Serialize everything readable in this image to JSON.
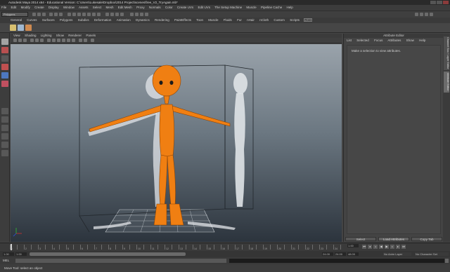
{
  "app": {
    "window_title": "Autodesk Maya 2014 x64 - Educational Version: C:\\Users\\Lukesale\\Dropbox\\2014 Project\\scenes\\free_V2_TryAgain.mb*"
  },
  "menubar": [
    "File",
    "Edit",
    "Modify",
    "Create",
    "Display",
    "Window",
    "Assets",
    "Select",
    "Mesh",
    "Edit Mesh",
    "Proxy",
    "Normals",
    "Color",
    "Create UVs",
    "Edit UVs",
    "The Setup Machine",
    "Muscle",
    "Pipeline Cache",
    "Help"
  ],
  "statusline": {
    "mode": "Polygons"
  },
  "shelf": {
    "tabs": [
      "General",
      "Curves",
      "Surfaces",
      "Polygons",
      "Subdivs",
      "Deformation",
      "Animation",
      "Dynamics",
      "Rendering",
      "PaintEffects",
      "Toon",
      "Muscle",
      "Fluids",
      "Fur",
      "nHair",
      "nCloth",
      "Custom",
      "Scripts",
      "Ross"
    ],
    "active_tab": "Ross"
  },
  "viewport": {
    "menu": [
      "View",
      "Shading",
      "Lighting",
      "Show",
      "Renderer",
      "Panels"
    ],
    "colors": {
      "character": "#f07f12",
      "bg_top": "#9aa3ab",
      "bg_bottom": "#2c343d"
    }
  },
  "attribute_editor": {
    "title": "Attribute Editor",
    "menu": [
      "List",
      "Selected",
      "Focus",
      "Attributes",
      "Show",
      "Help"
    ],
    "message": "Make a selection to view attributes.",
    "buttons": [
      "Select",
      "Load Attributes",
      "Copy Tab"
    ],
    "side_tabs": [
      "Channel Box / Layer Editor",
      "Attribute Editor"
    ]
  },
  "time": {
    "ticks": [
      "1",
      "2",
      "3",
      "4",
      "5",
      "6",
      "7",
      "8",
      "9",
      "10",
      "11",
      "12",
      "13",
      "14",
      "15",
      "16",
      "17",
      "18",
      "19",
      "20",
      "21",
      "22",
      "23",
      "24"
    ],
    "current_frame": "1.00",
    "range_start": "1.00",
    "playback_start": "1.00",
    "playback_end": "24.00",
    "range_end": "24.00",
    "end_total": "48.00",
    "anim_layer": "No Anim Layer",
    "character_set": "No Character Set"
  },
  "command_line": {
    "lang": "MEL"
  },
  "help_line": "Move Tool: select an object"
}
